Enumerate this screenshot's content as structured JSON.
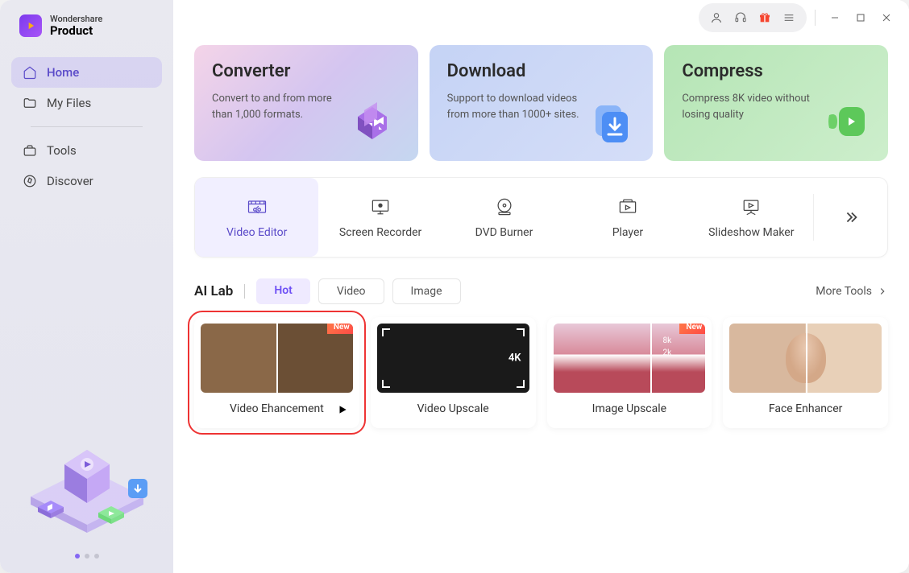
{
  "brand": {
    "top": "Wondershare",
    "bottom": "Product"
  },
  "nav": {
    "home": "Home",
    "myfiles": "My Files",
    "tools": "Tools",
    "discover": "Discover"
  },
  "hero": {
    "converter": {
      "title": "Converter",
      "desc": "Convert to and from more than 1,000 formats."
    },
    "download": {
      "title": "Download",
      "desc": "Support to download videos from more than 1000+ sites."
    },
    "compress": {
      "title": "Compress",
      "desc": "Compress 8K video without losing quality"
    }
  },
  "tools": {
    "videoEditor": "Video Editor",
    "screenRecorder": "Screen Recorder",
    "dvdBurner": "DVD Burner",
    "player": "Player",
    "slideshow": "Slideshow Maker"
  },
  "ailab": {
    "title": "AI Lab",
    "tabs": {
      "hot": "Hot",
      "video": "Video",
      "image": "Image"
    },
    "more": "More Tools"
  },
  "cards": {
    "videoEnhancement": "Video Ehancement",
    "videoUpscale": "Video Upscale",
    "imageUpscale": "Image Upscale",
    "faceEnhancer": "Face  Enhancer",
    "newBadge": "New",
    "res4k": "4K",
    "res8k": "8k",
    "res2k": "2k"
  }
}
